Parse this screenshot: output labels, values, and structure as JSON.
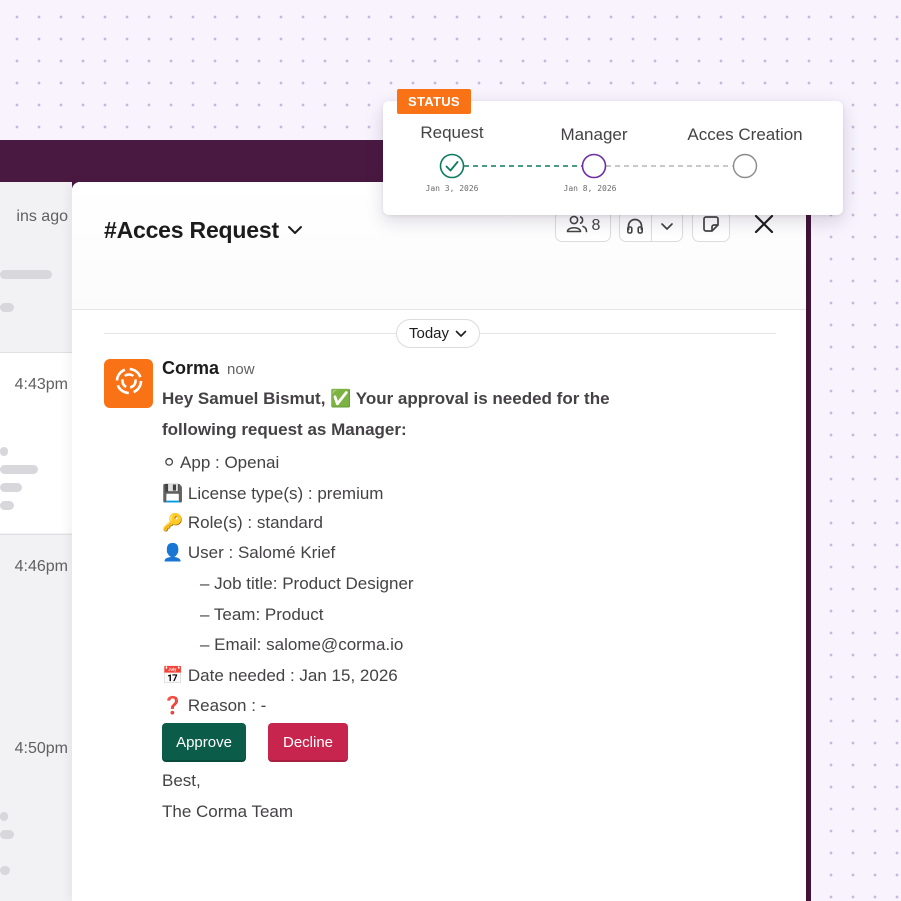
{
  "left_panel": {
    "times": [
      "ins ago",
      "4:43pm",
      "4:46pm",
      "4:50pm"
    ]
  },
  "header": {
    "channel_title": "#Acces Request",
    "member_count": "8"
  },
  "divider": {
    "today_label": "Today"
  },
  "message": {
    "sender": "Corma",
    "time": "now",
    "greeting_line1": "Hey Samuel Bismut, ✅ Your approval is needed for the",
    "greeting_line2": "following request as Manager:",
    "app": "⚪ App : Openai",
    "license": "💾 License type(s) : premium",
    "role": "🔑 Role(s) : standard",
    "user": "👤 User : Salomé Krief",
    "job_title": "– Job title: Product Designer",
    "team": "– Team: Product",
    "email": "– Email: salome@corma.io",
    "date_needed": "📅 Date needed : Jan 15, 2026",
    "reason": "❓ Reason : -",
    "approve_label": "Approve",
    "decline_label": "Decline",
    "signoff1": "Best,",
    "signoff2": "The Corma Team"
  },
  "status_card": {
    "badge": "STATUS",
    "steps": [
      {
        "label": "Request",
        "date": "Jan 3, 2026",
        "state": "done"
      },
      {
        "label": "Manager",
        "date": "Jan 8, 2026",
        "state": "current"
      },
      {
        "label": "Acces Creation",
        "date": "",
        "state": "pending"
      }
    ]
  },
  "colors": {
    "frame": "#4a1942",
    "brand_orange": "#f97316",
    "approve": "#0b5d4a",
    "decline": "#c7254e",
    "done": "#0f7a5f",
    "current": "#6b2fa3",
    "pending": "#8a8a8a"
  },
  "icons": [
    "members-icon",
    "headphones-icon",
    "chevron-down-icon",
    "canvas-icon",
    "close-icon",
    "corma-logo-icon",
    "check-icon"
  ]
}
